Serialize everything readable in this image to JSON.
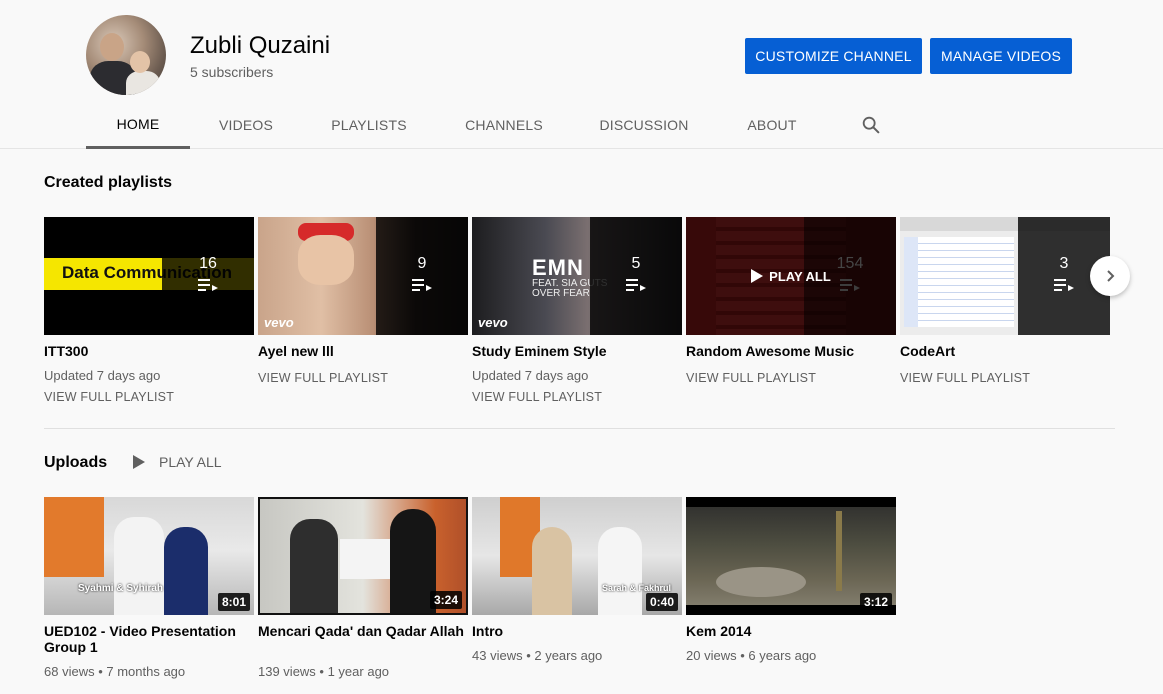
{
  "channel": {
    "name": "Zubli Quzaini",
    "subscribers": "5 subscribers",
    "customize_label": "CUSTOMIZE CHANNEL",
    "manage_label": "MANAGE VIDEOS"
  },
  "tabs": [
    {
      "label": "HOME",
      "active": true
    },
    {
      "label": "VIDEOS"
    },
    {
      "label": "PLAYLISTS"
    },
    {
      "label": "CHANNELS"
    },
    {
      "label": "DISCUSSION"
    },
    {
      "label": "ABOUT"
    }
  ],
  "playlists_section": {
    "title": "Created playlists",
    "items": [
      {
        "title": "ITT300",
        "count": "16",
        "updated": "Updated 7 days ago",
        "link": "VIEW FULL PLAYLIST",
        "thumb_text": "Data Communication"
      },
      {
        "title": "Ayel new lll",
        "count": "9",
        "link": "VIEW FULL PLAYLIST",
        "thumb_text": "vevo"
      },
      {
        "title": "Study Eminem Style",
        "count": "5",
        "updated": "Updated 7 days ago",
        "link": "VIEW FULL PLAYLIST",
        "thumb_text": "EMN",
        "thumb_sub": "FEAT. SIA GUTS OVER FEAR",
        "thumb_logo": "vevo"
      },
      {
        "title": "Random Awesome Music",
        "count": "154",
        "link": "VIEW FULL PLAYLIST",
        "hover_label": "PLAY ALL"
      },
      {
        "title": "CodeArt",
        "count": "3",
        "link": "VIEW FULL PLAYLIST"
      }
    ]
  },
  "uploads_section": {
    "title": "Uploads",
    "play_all": "PLAY ALL",
    "items": [
      {
        "title": "UED102 - Video Presentation Group 1",
        "views": "68 views",
        "age": "7 months ago",
        "duration": "8:01",
        "caption": "Syahmi & Syhirah"
      },
      {
        "title": "Mencari Qada' dan Qadar Allah",
        "views": "139 views",
        "age": "1 year ago",
        "duration": "3:24"
      },
      {
        "title": "Intro",
        "views": "43 views",
        "age": "2 years ago",
        "duration": "0:40",
        "caption": "Sarah & Fakhrul"
      },
      {
        "title": "Kem 2014",
        "views": "20 views",
        "age": "6 years ago",
        "duration": "3:12"
      }
    ]
  },
  "icons": {
    "search": "search-icon",
    "playlist": "playlist-icon",
    "play": "play-icon",
    "next": "chevron-right-icon"
  },
  "colors": {
    "accent": "#065fd4",
    "background": "#f9f9f9"
  }
}
